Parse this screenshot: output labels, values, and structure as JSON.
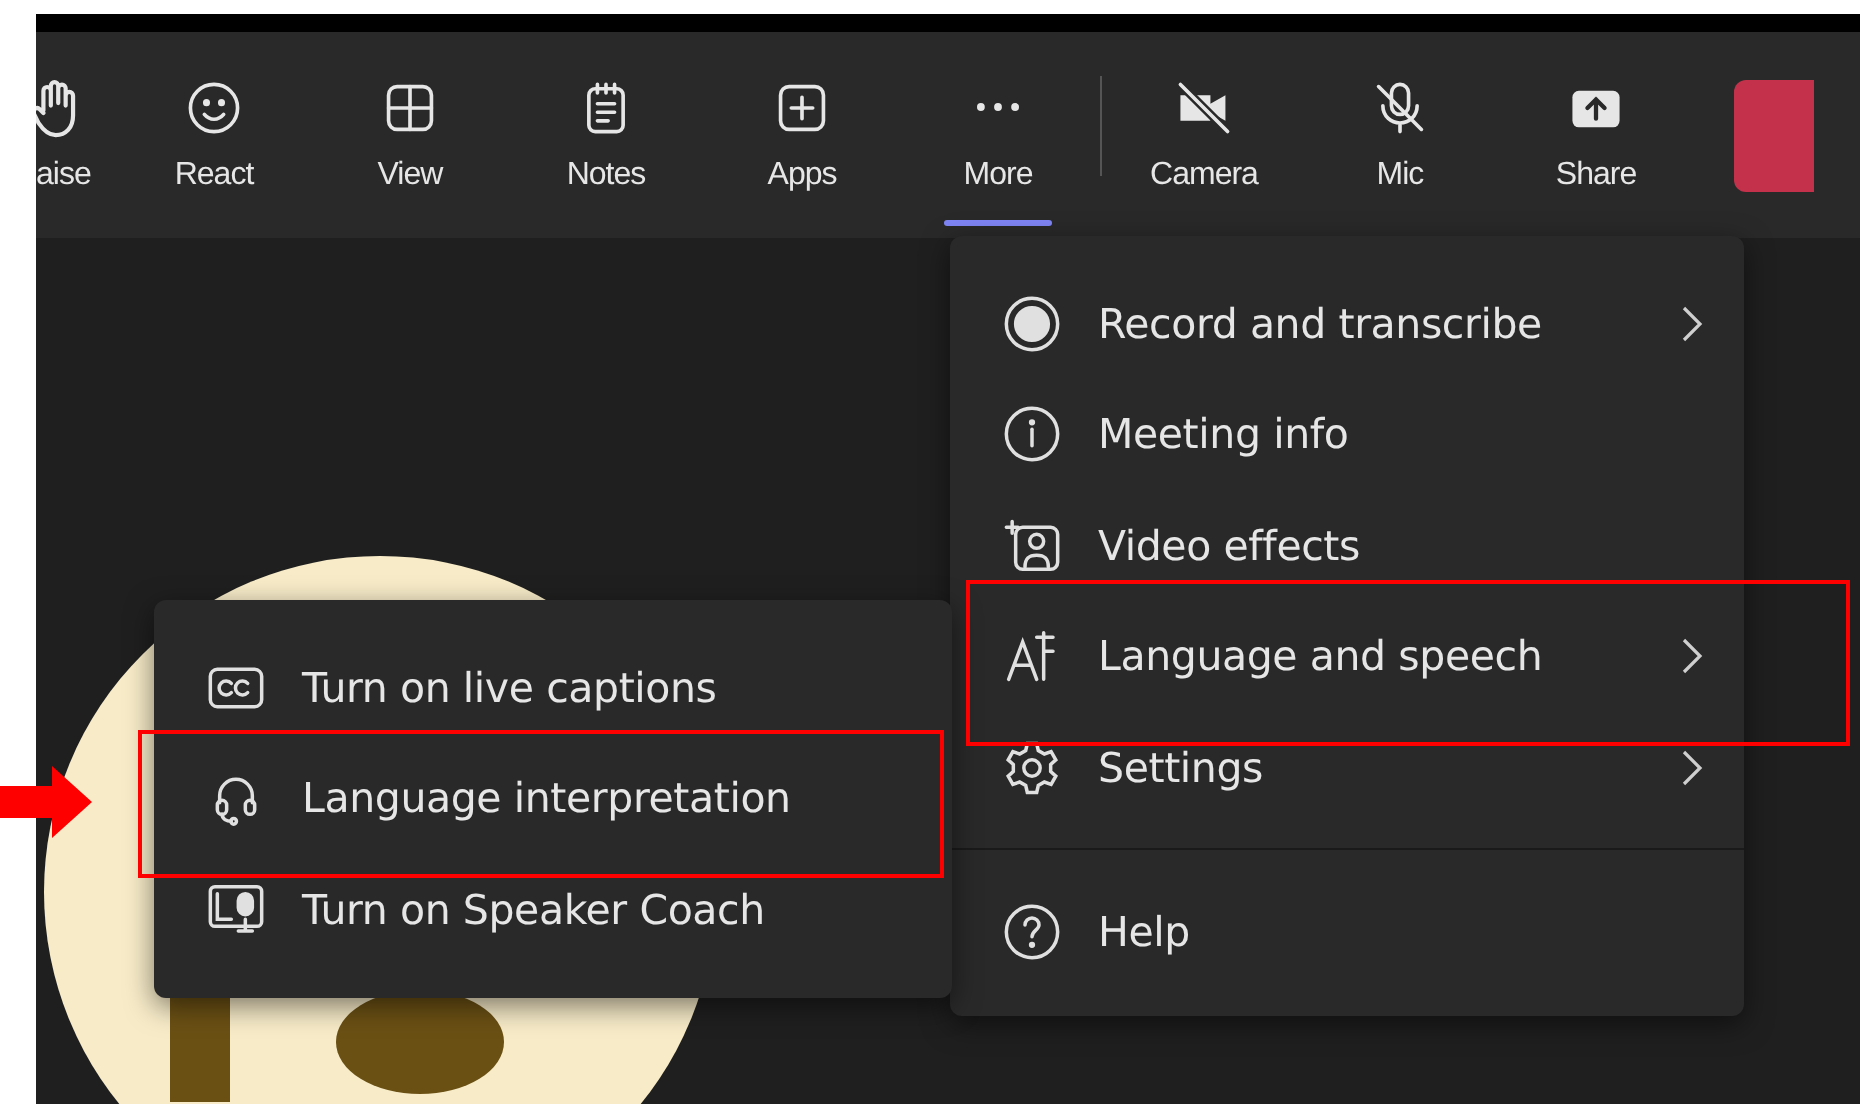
{
  "toolbar": {
    "items": [
      {
        "label": "aise",
        "kind": "hand",
        "selected": false
      },
      {
        "label": "React",
        "kind": "smile",
        "selected": false
      },
      {
        "label": "View",
        "kind": "grid",
        "selected": false
      },
      {
        "label": "Notes",
        "kind": "notes",
        "selected": false
      },
      {
        "label": "Apps",
        "kind": "plus",
        "selected": false
      },
      {
        "label": "More",
        "kind": "dots",
        "selected": true
      },
      {
        "label": "Camera",
        "kind": "camera-off",
        "selected": false
      },
      {
        "label": "Mic",
        "kind": "mic-off",
        "selected": false
      },
      {
        "label": "Share",
        "kind": "share",
        "selected": false
      }
    ]
  },
  "more_menu": {
    "groups": [
      [
        {
          "label": "Record and transcribe",
          "kind": "record",
          "submenu": true,
          "highlighted": false
        },
        {
          "label": "Meeting info",
          "kind": "info",
          "submenu": false,
          "highlighted": false
        },
        {
          "label": "Video effects",
          "kind": "effects",
          "submenu": false,
          "highlighted": false
        },
        {
          "label": "Language and speech",
          "kind": "language",
          "submenu": true,
          "highlighted": true
        },
        {
          "label": "Settings",
          "kind": "gear",
          "submenu": true,
          "highlighted": false
        }
      ],
      [
        {
          "label": "Help",
          "kind": "help",
          "submenu": false,
          "highlighted": false
        }
      ]
    ]
  },
  "language_menu": {
    "items": [
      {
        "label": "Turn on live captions",
        "kind": "cc",
        "highlighted": false
      },
      {
        "label": "Language interpretation",
        "kind": "headset",
        "highlighted": true
      },
      {
        "label": "Turn on Speaker Coach",
        "kind": "coach",
        "highlighted": false
      }
    ]
  }
}
